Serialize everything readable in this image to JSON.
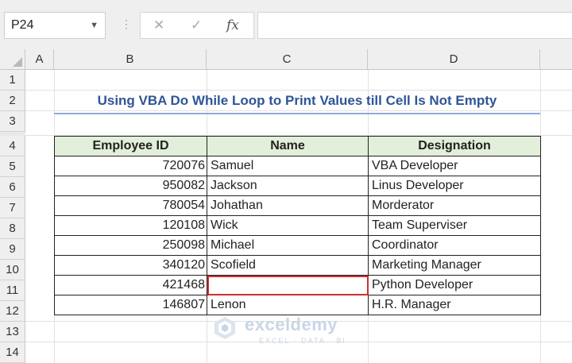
{
  "name_box": {
    "value": "P24"
  },
  "formula_bar": {
    "cancel_glyph": "✕",
    "enter_glyph": "✓",
    "fx_label": "fx",
    "formula": ""
  },
  "columns": [
    "A",
    "B",
    "C",
    "D"
  ],
  "rows": [
    "1",
    "2",
    "3",
    "4",
    "5",
    "6",
    "7",
    "8",
    "9",
    "10",
    "11",
    "12",
    "13",
    "14"
  ],
  "title": "Using VBA Do While Loop to Print Values till Cell Is Not Empty",
  "table": {
    "headers": [
      "Employee ID",
      "Name",
      "Designation"
    ],
    "rows": [
      {
        "id": "720076",
        "name": "Samuel",
        "designation": "VBA Developer"
      },
      {
        "id": "950082",
        "name": "Jackson",
        "designation": "Linus Developer"
      },
      {
        "id": "780054",
        "name": "Johathan",
        "designation": "Morderator"
      },
      {
        "id": "120108",
        "name": "Wick",
        "designation": "Team Superviser"
      },
      {
        "id": "250098",
        "name": "Michael",
        "designation": "Coordinator"
      },
      {
        "id": "340120",
        "name": "Scofield",
        "designation": "Marketing Manager"
      },
      {
        "id": "421468",
        "name": "",
        "designation": "Python Developer"
      },
      {
        "id": "146807",
        "name": "Lenon",
        "designation": "H.R. Manager"
      }
    ],
    "selected_empty_cell": "C11"
  },
  "watermark": {
    "name": "exceldemy",
    "tagline": "EXCEL · DATA · BI"
  },
  "colors": {
    "title": "#2f5597",
    "header_fill": "#e2efda",
    "selection": "#d12d2d",
    "underline": "#8eaadb"
  }
}
